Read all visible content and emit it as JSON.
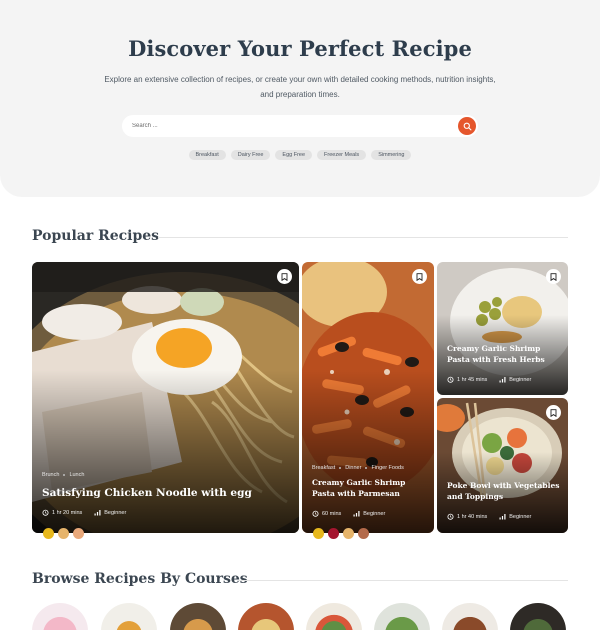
{
  "hero": {
    "title": "Discover Your Perfect Recipe",
    "description": "Explore an extensive collection of recipes, or create your own with detailed cooking methods, nutrition insights, and preparation times.",
    "search_placeholder": "Search ...",
    "tags": [
      "Breakfast",
      "Dairy Free",
      "Egg Free",
      "Freezer Meals",
      "Simmering"
    ]
  },
  "popular": {
    "heading": "Popular Recipes",
    "cards": [
      {
        "categories": [
          "Brunch",
          "Lunch"
        ],
        "title": "Satisfying Chicken Noodle with egg",
        "time": "1 hr 20 mins",
        "level": "Beginner"
      },
      {
        "categories": [
          "Breakfast",
          "Dinner",
          "Finger Foods"
        ],
        "title_line1": "Creamy Garlic Shrimp",
        "title_line2": "Pasta with Parmesan",
        "time": "60 mins",
        "level": "Beginner"
      },
      {
        "title_line1": "Creamy Garlic Shrimp",
        "title_line2": "Pasta with Fresh Herbs",
        "time": "1 hr 45 mins",
        "level": "Beginner"
      },
      {
        "title_line1": "Poke Bowl with Vegetables",
        "title_line2": "and Toppings",
        "time": "1 hr 40 mins",
        "level": "Beginner"
      }
    ]
  },
  "courses": {
    "heading": "Browse Recipes By Courses"
  },
  "colors": {
    "accent": "#e5562c",
    "heading": "#2e3d4c",
    "hero_bg": "#f4f4f4"
  },
  "icons": [
    "search-icon",
    "bookmark-icon",
    "clock-icon",
    "difficulty-bars-icon"
  ]
}
